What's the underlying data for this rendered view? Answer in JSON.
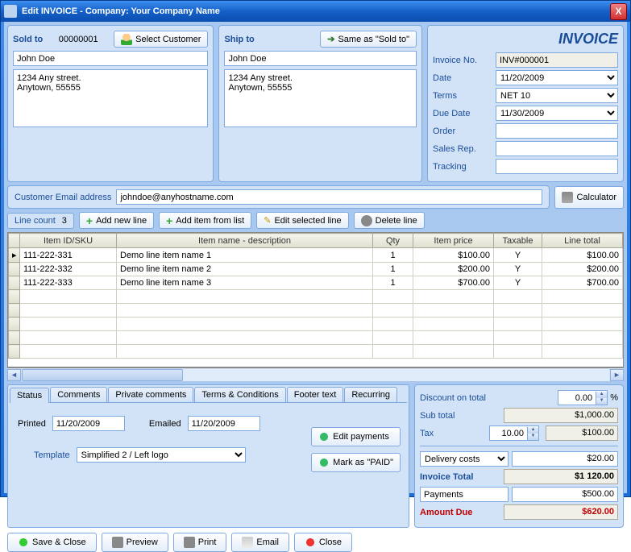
{
  "window": {
    "title": "Edit INVOICE - Company: Your Company Name"
  },
  "soldTo": {
    "title": "Sold to",
    "id": "00000001",
    "selectBtn": "Select Customer",
    "name": "John Doe",
    "address": "1234 Any street.\nAnytown, 55555"
  },
  "shipTo": {
    "title": "Ship to",
    "sameBtn": "Same as \"Sold to\"",
    "name": "John Doe",
    "address": "1234 Any street.\nAnytown, 55555"
  },
  "invHead": {
    "title": "INVOICE",
    "fields": {
      "invoiceNo": {
        "label": "Invoice No.",
        "value": "INV#000001"
      },
      "date": {
        "label": "Date",
        "value": "11/20/2009"
      },
      "terms": {
        "label": "Terms",
        "value": "NET 10"
      },
      "dueDate": {
        "label": "Due Date",
        "value": "11/30/2009"
      },
      "order": {
        "label": "Order",
        "value": ""
      },
      "salesRep": {
        "label": "Sales Rep.",
        "value": ""
      },
      "tracking": {
        "label": "Tracking",
        "value": ""
      }
    }
  },
  "email": {
    "label": "Customer Email address",
    "value": "johndoe@anyhostname.com",
    "calcBtn": "Calculator"
  },
  "toolbar": {
    "lineCountLabel": "Line count",
    "lineCount": "3",
    "addLine": "Add new line",
    "addItem": "Add item from list",
    "editLine": "Edit selected line",
    "deleteLine": "Delete line"
  },
  "grid": {
    "headers": [
      "Item ID/SKU",
      "Item name - description",
      "Qty",
      "Item price",
      "Taxable",
      "Line total"
    ],
    "rows": [
      {
        "sku": "111-222-331",
        "name": "Demo line item name 1",
        "qty": "1",
        "price": "$100.00",
        "tax": "Y",
        "total": "$100.00"
      },
      {
        "sku": "111-222-332",
        "name": "Demo line item name 2",
        "qty": "1",
        "price": "$200.00",
        "tax": "Y",
        "total": "$200.00"
      },
      {
        "sku": "111-222-333",
        "name": "Demo line item name 3",
        "qty": "1",
        "price": "$700.00",
        "tax": "Y",
        "total": "$700.00"
      }
    ]
  },
  "tabs": {
    "items": [
      "Status",
      "Comments",
      "Private comments",
      "Terms & Conditions",
      "Footer text",
      "Recurring"
    ],
    "status": {
      "printedLabel": "Printed",
      "printed": "11/20/2009",
      "emailedLabel": "Emailed",
      "emailed": "11/20/2009",
      "templateLabel": "Template",
      "template": "Simplified 2 / Left logo",
      "editPaymentsBtn": "Edit payments",
      "markPaidBtn": "Mark as \"PAID\""
    }
  },
  "totals": {
    "discountLabel": "Discount on total",
    "discount": "0.00",
    "discountUnit": "%",
    "subTotalLabel": "Sub total",
    "subTotal": "$1,000.00",
    "taxLabel": "Tax",
    "taxPct": "10.00",
    "taxAmt": "$100.00",
    "deliveryLabel": "Delivery costs",
    "delivery": "$20.00",
    "invoiceTotalLabel": "Invoice Total",
    "invoiceTotal": "$1 120.00",
    "paymentsLabel": "Payments",
    "payments": "$500.00",
    "amountDueLabel": "Amount Due",
    "amountDue": "$620.00"
  },
  "bottomButtons": {
    "save": "Save & Close",
    "preview": "Preview",
    "print": "Print",
    "email": "Email",
    "close": "Close"
  }
}
